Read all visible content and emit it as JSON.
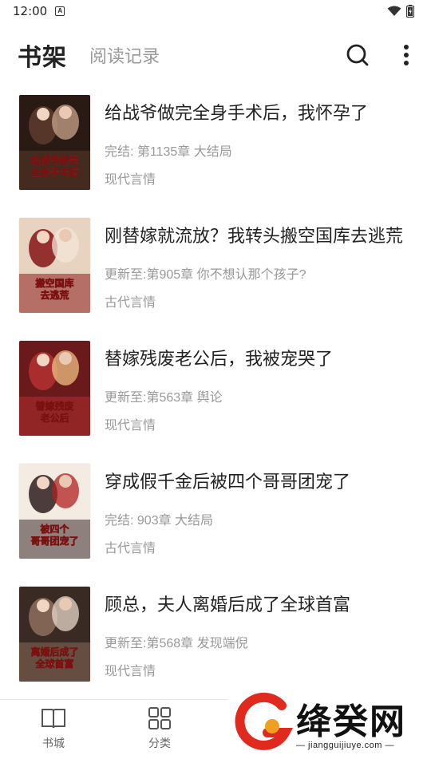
{
  "status_bar": {
    "time": "12:00",
    "notification_letter": "A"
  },
  "header": {
    "active_tab": "书架",
    "tab_history": "阅读记录"
  },
  "books": [
    {
      "title": "给战爷做完全身手术后，我怀孕了",
      "progress": "完结: 第1135章 大结局",
      "category": "现代言情",
      "cover_text": [
        "给战爷做完",
        "全身手术后"
      ],
      "cover_colors": [
        "#2a1a14",
        "#5a3a2a",
        "#c9a48a"
      ]
    },
    {
      "title": "刚替嫁就流放？我转头搬空国库去逃荒",
      "progress": "更新至:第905章 你不想认那个孩子?",
      "category": "古代言情",
      "cover_text": [
        "搬空国库",
        "去逃荒"
      ],
      "cover_colors": [
        "#e8d2c0",
        "#8b1e1e",
        "#f3e6da"
      ]
    },
    {
      "title": "替嫁残废老公后，我被宠哭了",
      "progress": "更新至:第563章 舆论",
      "category": "现代言情",
      "cover_text": [
        "替嫁残废",
        "老公后"
      ],
      "cover_colors": [
        "#6a1a1a",
        "#b03030",
        "#f0c080"
      ]
    },
    {
      "title": "穿成假千金后被四个哥哥团宠了",
      "progress": "完结: 903章 大结局",
      "category": "古代言情",
      "cover_text": [
        "被四个",
        "哥哥团宠了"
      ],
      "cover_colors": [
        "#f4ece2",
        "#3a2a2a",
        "#b02020"
      ]
    },
    {
      "title": "顾总，夫人离婚后成了全球首富",
      "progress": "更新至:第568章 发现端倪",
      "category": "现代言情",
      "cover_text": [
        "离婚后成了",
        "全球首富"
      ],
      "cover_colors": [
        "#3a2a24",
        "#8a6a5a",
        "#e8d8c8"
      ]
    }
  ],
  "bottom_nav": {
    "bookstore_label": "书城",
    "category_label": "分类"
  },
  "watermark": {
    "brand": "绛癸网",
    "url": "— jiangguijiuye.com —"
  },
  "colors": {
    "text_primary": "#222222",
    "text_secondary": "#999999",
    "watermark_red": "#e02a1e",
    "watermark_orange": "#f0a020"
  }
}
